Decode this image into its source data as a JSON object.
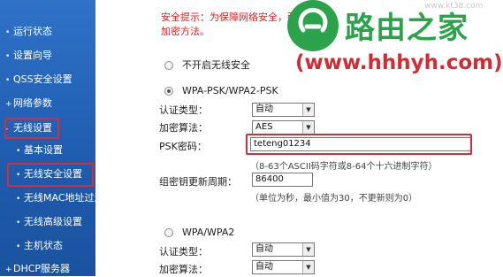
{
  "sidebar": {
    "items": [
      {
        "label": "运行状态"
      },
      {
        "label": "设置向导"
      },
      {
        "label": "QSS安全设置"
      },
      {
        "label": "网络参数"
      },
      {
        "label": "无线设置"
      },
      {
        "label": "基本设置"
      },
      {
        "label": "无线安全设置"
      },
      {
        "label": "无线MAC地址过滤"
      },
      {
        "label": "无线高级设置"
      },
      {
        "label": "主机状态"
      },
      {
        "label": "DHCP服务器"
      }
    ]
  },
  "warning": {
    "line1": "安全提示：为保障网络安全，强",
    "line2": "加密方法。"
  },
  "options": {
    "no_security": "不开启无线安全",
    "wpa_psk": "WPA-PSK/WPA2-PSK",
    "wpa": "WPA/WPA2"
  },
  "psk_section": {
    "auth_label": "认证类型：",
    "auth_value": "自动",
    "enc_label": "加密算法：",
    "enc_value": "AES",
    "psk_label": "PSK密码：",
    "psk_value": "teteng01234",
    "psk_hint": "（8-63个ASCII码字符或8-64个十六进制字符）",
    "renew_label": "组密钥更新周期：",
    "renew_value": "86400",
    "renew_hint": "（单位为秒，最小值为30，不更新则为0）"
  },
  "wpa_section": {
    "auth_label": "认证类型：",
    "auth_value": "自动",
    "enc_label": "加密算法：",
    "enc_value": "自动"
  },
  "watermark": {
    "title": "路由之家",
    "url": "(www.hhhyh.com)",
    "site": "www.kt38.com"
  },
  "colors": {
    "sidebar": "#2563b8",
    "highlight": "#d42d3c",
    "warning_text": "#e02020",
    "watermark_green": "#2aa34a",
    "watermark_red": "#d12b35"
  }
}
